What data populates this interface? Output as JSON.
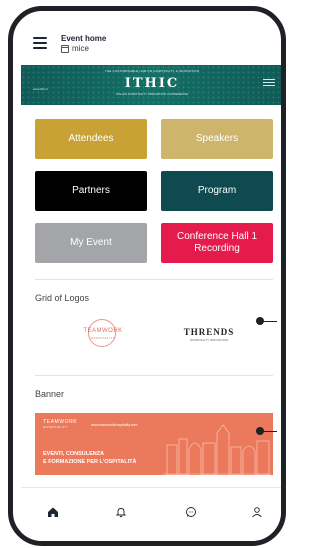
{
  "header": {
    "title": "Event home",
    "subtitle": "mice"
  },
  "hero": {
    "tagline": "THE CUSTOMISABLE HUB ON HOSPITALITY & INNOVATION",
    "logo": "ITHIC",
    "logo_sub": "ITALIAN HOSPITALITY INNOVATION CONFERENCE",
    "left_text": "www.ithic.it"
  },
  "tiles": [
    {
      "label": "Attendees",
      "color": "#c8a235"
    },
    {
      "label": "Speakers",
      "color": "#cdb56b"
    },
    {
      "label": "Partners",
      "color": "#000000"
    },
    {
      "label": "Program",
      "color": "#0e4a4f"
    },
    {
      "label": "My Event",
      "color": "#a3a5a8"
    },
    {
      "label": "Conference Hall 1 Recording",
      "color": "#e41b4c"
    }
  ],
  "sections": {
    "logos_title": "Grid of Logos",
    "banner_title": "Banner"
  },
  "logos": {
    "teamwork": {
      "name": "TEAMWORK",
      "sub": "HOSPITALITY"
    },
    "threns": {
      "name": "THRENDS",
      "sub": "HOSPITALITY INNOVATION"
    }
  },
  "promo": {
    "brand": "TEAMWORK",
    "brand_sub": "HOSPITALITY",
    "url": "www.teamworkhospitality.com",
    "line1": "EVENTI, CONSULENZA",
    "line2": "E FORMAZIONE PER L'OSPITALITÀ"
  },
  "nav": [
    {
      "icon": "home-icon"
    },
    {
      "icon": "bell-icon"
    },
    {
      "icon": "chat-icon"
    },
    {
      "icon": "user-icon"
    }
  ]
}
